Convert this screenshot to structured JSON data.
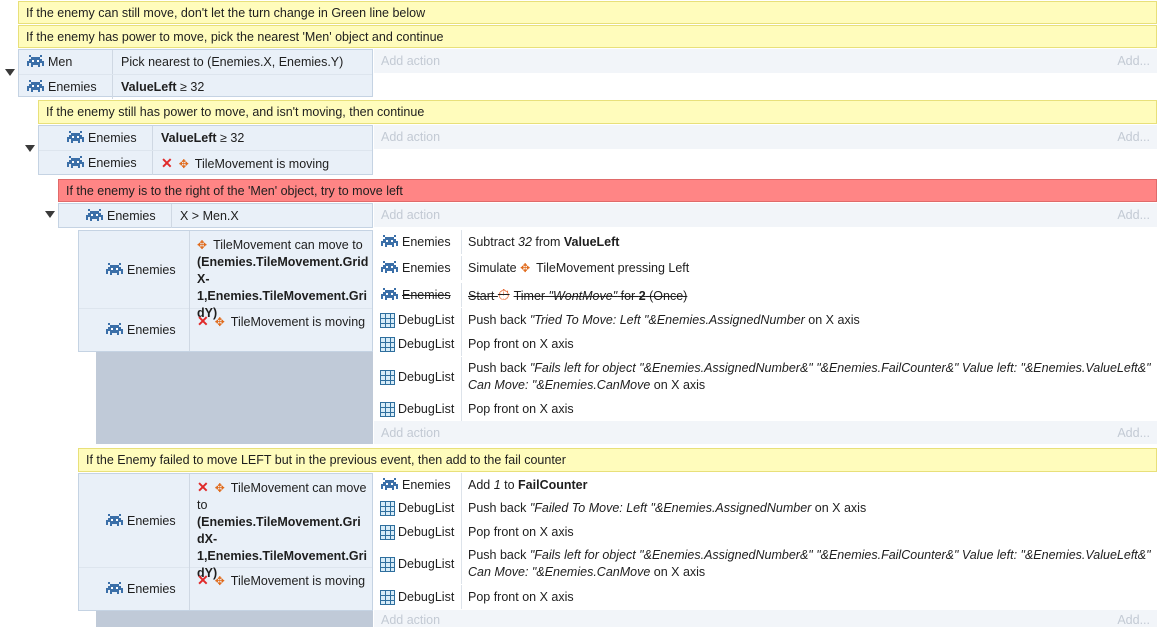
{
  "comments": {
    "c1": "If the enemy can still move, don't let the turn change in Green line below",
    "c2": "If the enemy has power to move, pick the nearest 'Men' object and continue",
    "c3": "If the enemy still has power to move, and isn't moving, then continue",
    "c4": "If the enemy is to the right of the 'Men' object, try to move left",
    "c5": "If the Enemy failed to move LEFT but in the previous event, then add to the fail counter"
  },
  "labels": {
    "add_action": "Add action",
    "add": "Add..."
  },
  "objects": {
    "men": "Men",
    "enemies": "Enemies",
    "debuglist": "DebugList"
  },
  "event1": {
    "cond1_text": "Pick nearest to (Enemies.X, Enemies.Y)",
    "cond2_bold": "ValueLeft",
    "cond2_rest": " ≥ 32"
  },
  "event2": {
    "cond1_bold": "ValueLeft",
    "cond1_rest": " ≥ 32",
    "cond2_text": "TileMovement is moving"
  },
  "event3": {
    "cond1_text": "X > Men.X"
  },
  "event4": {
    "cond1_pre": "TileMovement can move to ",
    "cond1_bold": "(Enemies.TileMovement.GridX-1,Enemies.TileMovement.GridY)",
    "cond2_text": "TileMovement is moving",
    "actions": [
      {
        "pre": "Subtract ",
        "it": "32",
        "mid": " from ",
        "bold": "ValueLeft"
      },
      {
        "pre": "Simulate ",
        "rest": "TileMovement pressing Left"
      },
      {
        "pre": "Start ",
        "timer": "Timer ",
        "it": "\"WontMove\"",
        "mid": " for ",
        "bold": "2",
        "end": " (Once)"
      },
      {
        "pre": "Push back ",
        "it": "\"Tried To Move: Left \"&Enemies.AssignedNumber",
        "end": " on X axis"
      },
      {
        "text": "Pop front on X axis"
      },
      {
        "pre": "Push back ",
        "it": "\"Fails left for object \"&Enemies.AssignedNumber&\" \"&Enemies.FailCounter&\" Value left: \"&Enemies.ValueLeft&\"",
        "it2": "Can Move: \"&Enemies.CanMove",
        "end": " on X axis"
      },
      {
        "text": "Pop front on X axis"
      }
    ]
  },
  "event5": {
    "cond1_pre": "TileMovement can move to ",
    "cond1_bold": "(Enemies.TileMovement.GridX-1,Enemies.TileMovement.GridY)",
    "cond2_text": "TileMovement is moving",
    "actions": [
      {
        "pre": "Add ",
        "it": "1",
        "mid": " to ",
        "bold": "FailCounter"
      },
      {
        "pre": "Push back ",
        "it": "\"Failed To Move: Left \"&Enemies.AssignedNumber",
        "end": " on X axis"
      },
      {
        "text": "Pop front on X axis"
      },
      {
        "pre": "Push back ",
        "it": "\"Fails left for object \"&Enemies.AssignedNumber&\" \"&Enemies.FailCounter&\" Value left: \"&Enemies.ValueLeft&\"",
        "it2": "Can Move: \"&Enemies.CanMove",
        "end": " on X axis"
      },
      {
        "text": "Pop front on X axis"
      }
    ]
  }
}
